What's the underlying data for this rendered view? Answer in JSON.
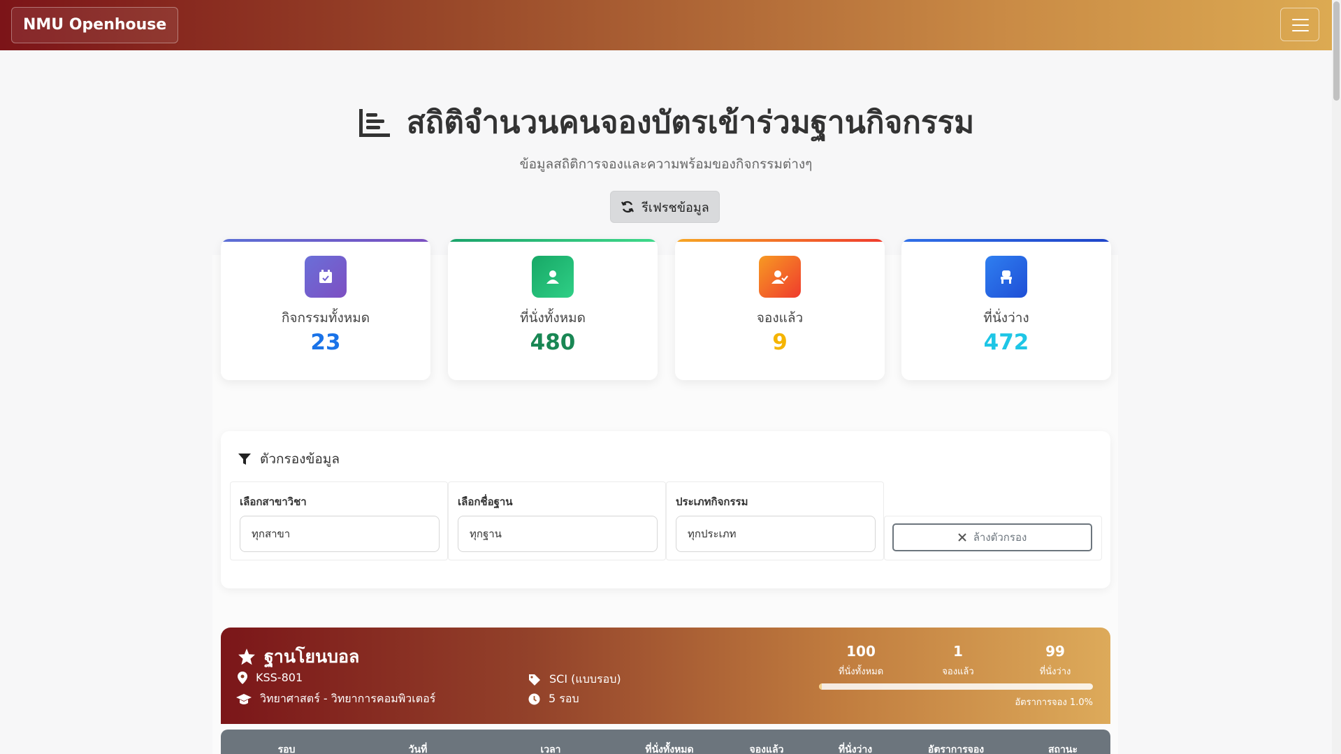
{
  "navbar": {
    "brand": "NMU Openhouse",
    "menu_icon": "hamburger-icon"
  },
  "header": {
    "title": "สถิติจำนวนคนจองบัตรเข้าร่วมฐานกิจกรรม",
    "title_icon": "bar-chart-icon",
    "subtitle": "ข้อมูลสถิติการจองและความพร้อมของกิจกรรมต่างๆ",
    "refresh_label": "รีเฟรชข้อมูล"
  },
  "stats": [
    {
      "label": "กิจกรรมทั้งหมด",
      "value": "23",
      "icon": "calendar-check-icon",
      "color": "#1a73e8",
      "icon_bg": "#6a5acd",
      "bar": "#6a5acd"
    },
    {
      "label": "ที่นั่งทั้งหมด",
      "value": "480",
      "icon": "user-icon",
      "color": "#198754",
      "icon_bg": "#20b56e",
      "bar": "#20c77a"
    },
    {
      "label": "จองแล้ว",
      "value": "9",
      "icon": "user-check-icon",
      "color": "#f5b400",
      "icon_bg": "#f4511e",
      "bar": "#f4511e"
    },
    {
      "label": "ที่นั่งว่าง",
      "value": "472",
      "icon": "chair-icon",
      "color": "#1ec6e6",
      "icon_bg": "#2563eb",
      "bar": "#2563eb"
    }
  ],
  "filters": {
    "title": "ตัวกรองข้อมูล",
    "groups": [
      {
        "label": "เลือกสาขาวิชา",
        "value": "ทุกสาขา"
      },
      {
        "label": "เลือกชื่อฐาน",
        "value": "ทุกฐาน"
      },
      {
        "label": "ประเภทกิจกรรม",
        "value": "ทุกประเภท"
      }
    ],
    "clear_label": "ล้างตัวกรอง"
  },
  "activity": {
    "name": "ฐานโยนบอล",
    "location": "KSS-801",
    "faculty": "วิทยาศาสตร์ - วิทยาการคอมพิวเตอร์",
    "type": "SCI (แบบรอบ)",
    "rounds": "5 รอบ",
    "total": "100",
    "total_label": "ที่นั่งทั้งหมด",
    "booked": "1",
    "booked_label": "จองแล้ว",
    "available": "99",
    "available_label": "ที่นั่งว่าง",
    "progress": 0.01,
    "rate_text": "อัตราการจอง 1.0%"
  },
  "table": {
    "headers": [
      "รอบ",
      "วันที่",
      "เวลา",
      "ที่นั่งทั้งหมด",
      "จองแล้ว",
      "ที่นั่งว่าง",
      "อัตราการจอง",
      "สถานะ"
    ]
  }
}
